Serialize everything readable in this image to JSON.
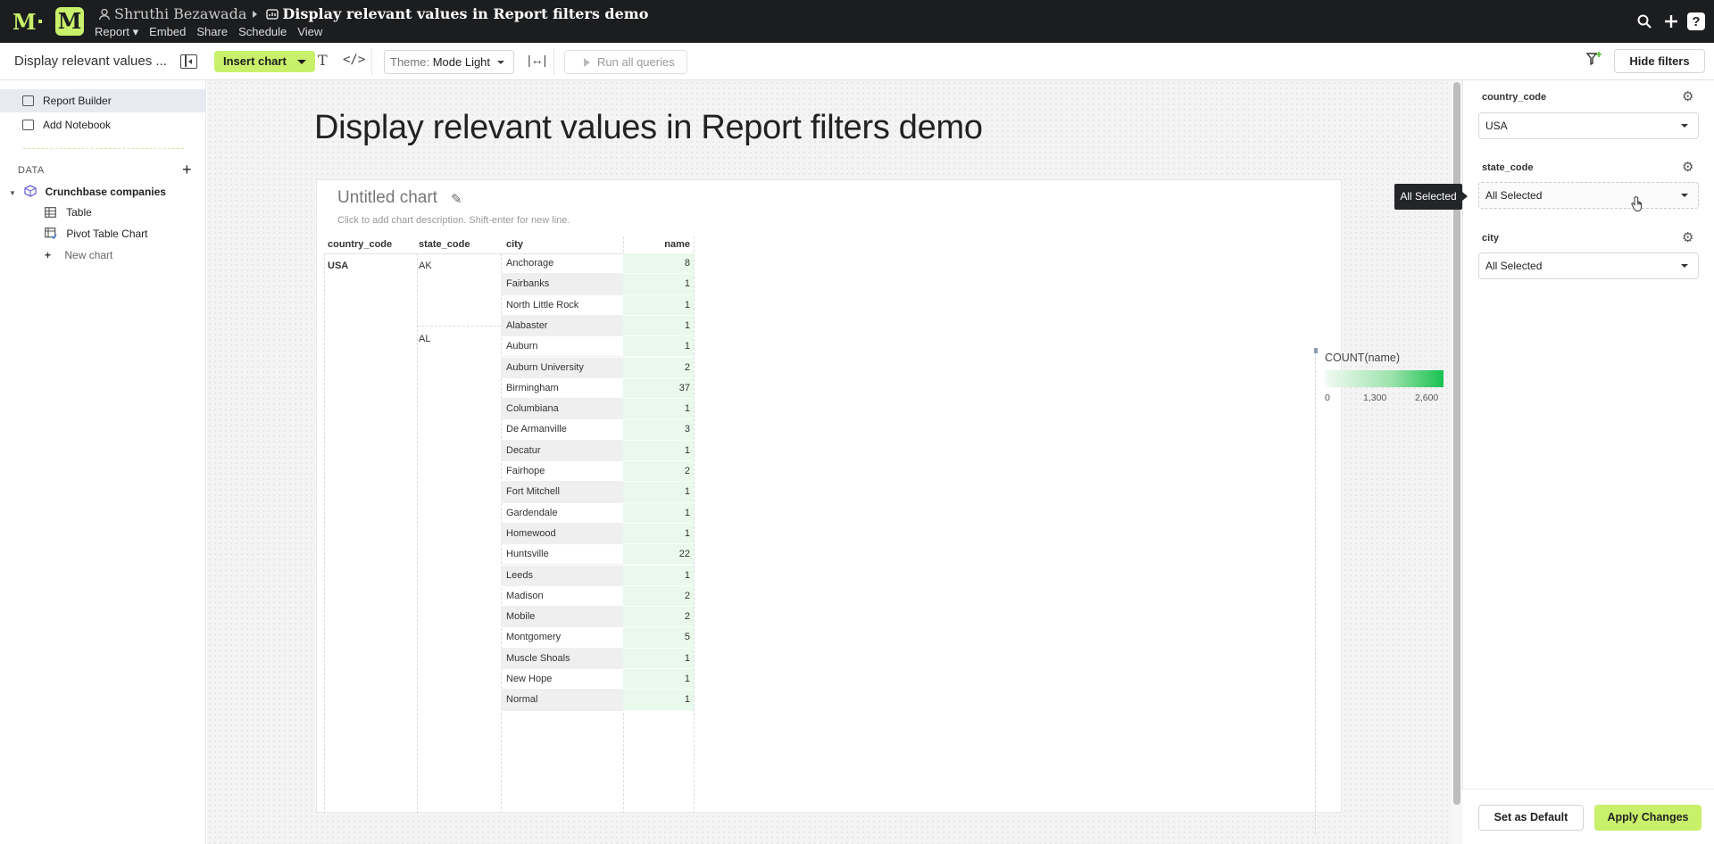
{
  "topbar": {
    "logo": "M",
    "user": "Shruthi Bezawada",
    "report_title": "Display relevant values in Report filters demo",
    "menu": [
      "Report ▾",
      "Embed",
      "Share",
      "Schedule",
      "View"
    ],
    "icons": [
      "search-icon",
      "plus-icon",
      "help-icon"
    ]
  },
  "toolbar": {
    "doc_name": "Display relevant values ...",
    "insert_chart": "Insert chart",
    "theme_label": "Theme:",
    "theme_value": "Mode Light",
    "run_all": "Run all queries",
    "hide_filters": "Hide filters"
  },
  "sidebar": {
    "items": [
      {
        "label": "Report Builder",
        "icon": "report-builder-icon",
        "active": true
      },
      {
        "label": "Add Notebook",
        "icon": "notebook-icon",
        "active": false
      }
    ],
    "data_header": "DATA",
    "datasource": "Crunchbase companies",
    "children": [
      {
        "label": "Table",
        "icon": "table-icon"
      },
      {
        "label": "Pivot Table Chart",
        "icon": "pivot-table-icon"
      },
      {
        "label": "New chart",
        "icon": "plus-icon"
      }
    ]
  },
  "report": {
    "title": "Display relevant values in Report filters demo",
    "chart": {
      "title": "Untitled chart",
      "description_placeholder": "Click to add chart description. Shift-enter for new line.",
      "columns": [
        "country_code",
        "state_code",
        "city",
        "name"
      ],
      "country": "USA",
      "states": [
        "AK",
        "AL"
      ],
      "rows": [
        {
          "city": "Anchorage",
          "value": 8
        },
        {
          "city": "Fairbanks",
          "value": 1
        },
        {
          "city": "North Little Rock",
          "value": 1
        },
        {
          "city": "Alabaster",
          "value": 1
        },
        {
          "city": "Auburn",
          "value": 1
        },
        {
          "city": "Auburn University",
          "value": 2
        },
        {
          "city": "Birmingham",
          "value": 37
        },
        {
          "city": "Columbiana",
          "value": 1
        },
        {
          "city": "De Armanville",
          "value": 3
        },
        {
          "city": "Decatur",
          "value": 1
        },
        {
          "city": "Fairhope",
          "value": 2
        },
        {
          "city": "Fort Mitchell",
          "value": 1
        },
        {
          "city": "Gardendale",
          "value": 1
        },
        {
          "city": "Homewood",
          "value": 1
        },
        {
          "city": "Huntsville",
          "value": 22
        },
        {
          "city": "Leeds",
          "value": 1
        },
        {
          "city": "Madison",
          "value": 2
        },
        {
          "city": "Mobile",
          "value": 2
        },
        {
          "city": "Montgomery",
          "value": 5
        },
        {
          "city": "Muscle Shoals",
          "value": 1
        },
        {
          "city": "New Hope",
          "value": 1
        },
        {
          "city": "Normal",
          "value": 1
        }
      ],
      "legend": {
        "title": "COUNT(name)",
        "ticks": [
          "0",
          "1,300",
          "2,600"
        ],
        "color_low": "#f2fbf4",
        "color_high": "#17c150"
      }
    }
  },
  "filters": {
    "items": [
      {
        "label": "country_code",
        "value": "USA"
      },
      {
        "label": "state_code",
        "value": "All Selected"
      },
      {
        "label": "city",
        "value": "All Selected"
      }
    ],
    "tooltip": "All Selected",
    "set_default": "Set as Default",
    "apply": "Apply Changes"
  }
}
